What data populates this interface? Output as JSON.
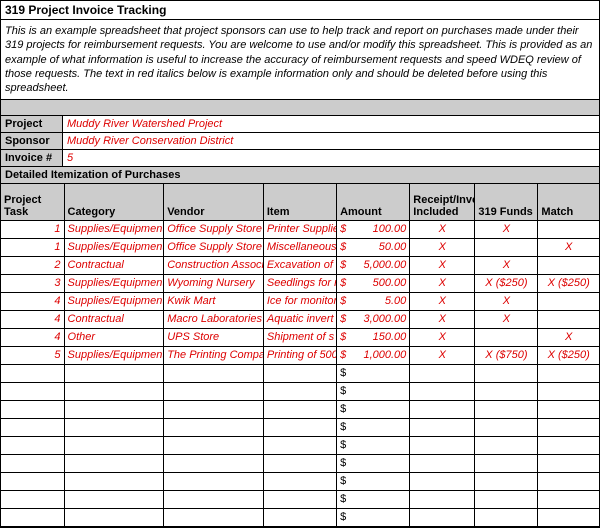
{
  "title": "319 Project Invoice Tracking",
  "description": "This is an example spreadsheet that project sponsors can use to help track and report on purchases made under their 319 projects for reimbursement requests.  You are welcome to use and/or modify this spreadsheet.  This is provided as an example of what information is useful to increase the accuracy of reimbursement requests and speed WDEQ review of those requests.  The text in red italics below is example information only and should be deleted before using this spreadsheet.",
  "meta": {
    "project_label": "Project",
    "project_value": "Muddy River Watershed Project",
    "sponsor_label": "Sponsor",
    "sponsor_value": "Muddy River Conservation District",
    "invoice_label": "Invoice #",
    "invoice_value": "5"
  },
  "section_header": "Detailed Itemization of Purchases",
  "columns": {
    "task": "Project Task",
    "category": "Category",
    "vendor": "Vendor",
    "item": "Item",
    "amount": "Amount",
    "receipt": "Receipt/Invoice Included",
    "funds": "319 Funds",
    "match": "Match"
  },
  "currency": "$",
  "rows": [
    {
      "task": "1",
      "category": "Supplies/Equipment",
      "vendor": "Office Supply Store",
      "item": "Printer Supplie",
      "amount": "100.00",
      "receipt": "X",
      "funds": "X",
      "match": ""
    },
    {
      "task": "1",
      "category": "Supplies/Equipment",
      "vendor": "Office Supply Store",
      "item": "Miscellaneous",
      "amount": "50.00",
      "receipt": "X",
      "funds": "",
      "match": "X"
    },
    {
      "task": "2",
      "category": "Contractual",
      "vendor": "Construction Associat",
      "item": "Excavation of",
      "amount": "5,000.00",
      "receipt": "X",
      "funds": "X",
      "match": ""
    },
    {
      "task": "3",
      "category": "Supplies/Equipment",
      "vendor": "Wyoming Nursery",
      "item": "Seedlings for r",
      "amount": "500.00",
      "receipt": "X",
      "funds": "X ($250)",
      "match": "X ($250)"
    },
    {
      "task": "4",
      "category": "Supplies/Equipment",
      "vendor": "Kwik Mart",
      "item": "Ice for monitor",
      "amount": "5.00",
      "receipt": "X",
      "funds": "X",
      "match": ""
    },
    {
      "task": "4",
      "category": "Contractual",
      "vendor": "Macro Laboratories",
      "item": "Aquatic invert",
      "amount": "3,000.00",
      "receipt": "X",
      "funds": "X",
      "match": ""
    },
    {
      "task": "4",
      "category": "Other",
      "vendor": "UPS Store",
      "item": "Shipment of s",
      "amount": "150.00",
      "receipt": "X",
      "funds": "",
      "match": "X"
    },
    {
      "task": "5",
      "category": "Supplies/Equipment",
      "vendor": "The Printing Company",
      "item": "Printing of 500",
      "amount": "1,000.00",
      "receipt": "X",
      "funds": "X ($750)",
      "match": "X ($250)"
    }
  ],
  "empty_rows": 9
}
